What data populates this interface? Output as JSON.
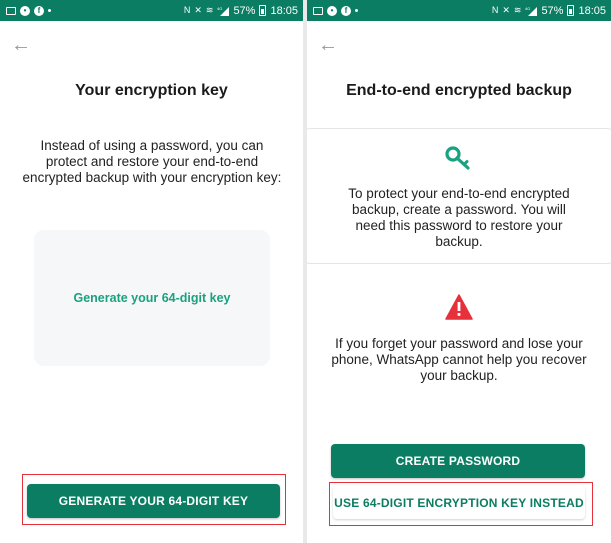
{
  "status_bar": {
    "battery": "57%",
    "time": "18:05",
    "network": "4G"
  },
  "left_screen": {
    "title": "Your encryption key",
    "description": "Instead of using a password, you can protect and restore your end-to-end encrypted backup with your encryption key:",
    "generate_link": "Generate your 64-digit key",
    "primary_button": "GENERATE YOUR 64-DIGIT KEY"
  },
  "right_screen": {
    "title": "End-to-end encrypted backup",
    "password_info": "To protect your end-to-end encrypted backup, create a password. You will need this password to restore your backup.",
    "warning_info": "If you forget your password and lose your phone, WhatsApp cannot help you recover your backup.",
    "primary_button": "CREATE PASSWORD",
    "secondary_button": "USE 64-DIGIT ENCRYPTION KEY INSTEAD"
  },
  "icons": {
    "back": "arrow-left-icon",
    "key": "key-icon",
    "warning": "warning-icon"
  },
  "colors": {
    "brand_green": "#0b7d62",
    "link_green": "#1aa17f",
    "warning_red": "#e6303a",
    "highlight_red": "#e6303a"
  }
}
